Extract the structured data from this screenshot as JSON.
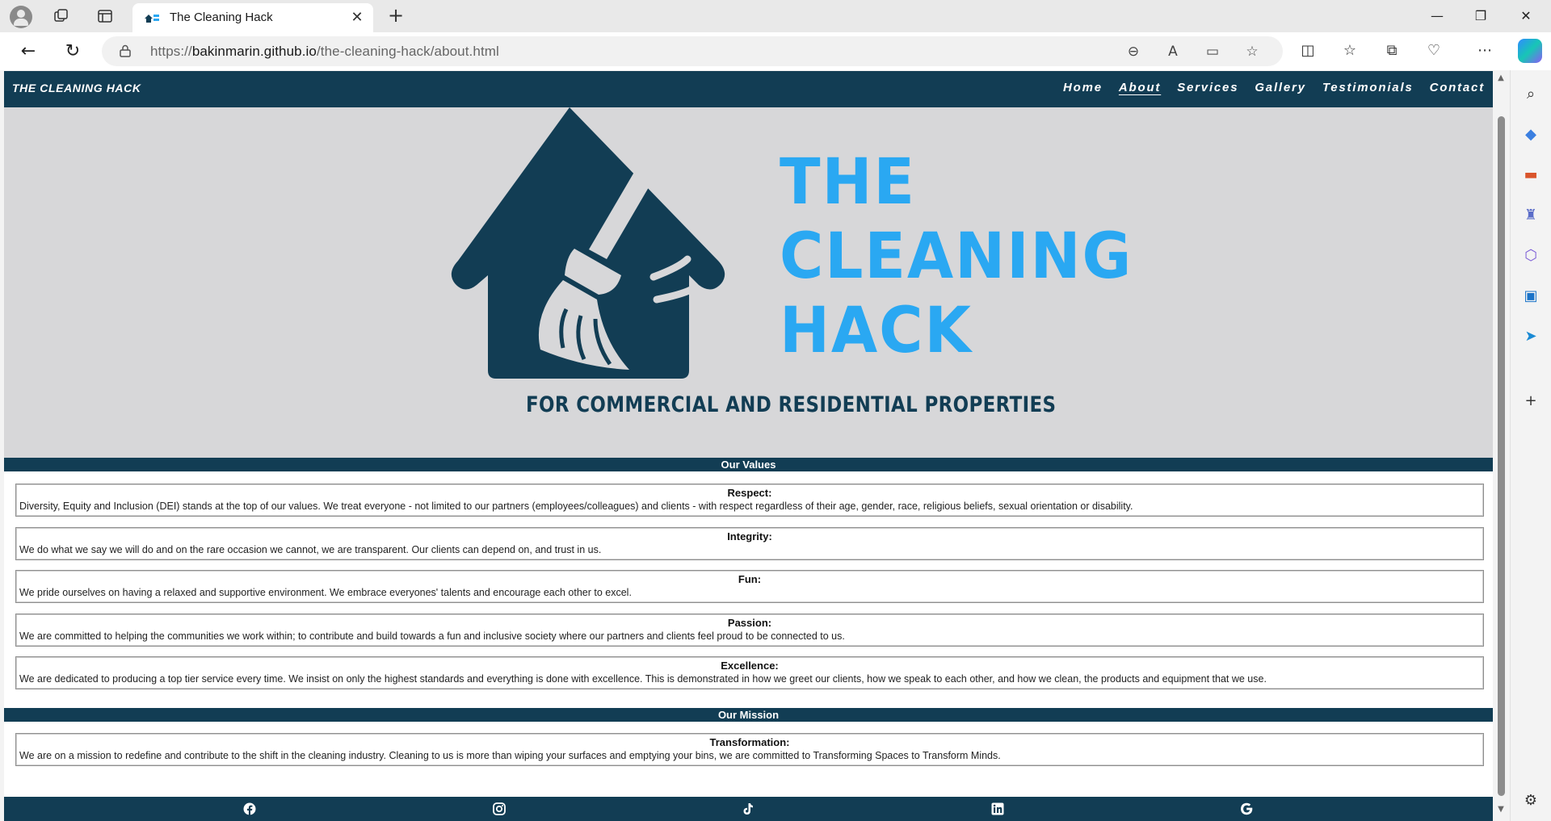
{
  "browser": {
    "tab_title": "The Cleaning Hack",
    "url_prefix": "https://",
    "url_host": "bakinmarin.github.io",
    "url_path": "/the-cleaning-hack/about.html"
  },
  "site": {
    "brand": "THE CLEANING HACK",
    "nav": [
      "Home",
      "About",
      "Services",
      "Gallery",
      "Testimonials",
      "Contact"
    ],
    "active_nav": "About",
    "logo_lines": [
      "THE",
      "CLEANING",
      "HACK"
    ],
    "tagline": "FOR COMMERCIAL AND RESIDENTIAL PROPERTIES",
    "values_heading": "Our Values",
    "values": [
      {
        "title": "Respect:",
        "text": "Diversity, Equity and Inclusion (DEI) stands at the top of our values. We treat everyone - not limited to our partners (employees/colleagues) and clients - with respect regardless of their age, gender, race, religious beliefs, sexual orientation or disability."
      },
      {
        "title": "Integrity:",
        "text": "We do what we say we will do and on the rare occasion we cannot, we are transparent. Our clients can depend on, and trust in us."
      },
      {
        "title": "Fun:",
        "text": "We pride ourselves on having a relaxed and supportive environment. We embrace everyones' talents and encourage each other to excel."
      },
      {
        "title": "Passion:",
        "text": "We are committed to helping the communities we work within; to contribute and build towards a fun and inclusive society where our partners and clients feel proud to be connected to us."
      },
      {
        "title": "Excellence:",
        "text": "We are dedicated to producing a top tier service every time. We insist on only the highest standards and everything is done with excellence. This is demonstrated in how we greet our clients, how we speak to each other, and how we clean, the products and equipment that we use."
      }
    ],
    "mission_heading": "Our Mission",
    "mission": {
      "title": "Transformation:",
      "text": "We are on a mission to redefine and contribute to the shift in the cleaning industry. Cleaning to us is more than wiping your surfaces and emptying your bins, we are committed to Transforming Spaces to Transform Minds."
    },
    "social_icons": [
      "facebook-icon",
      "instagram-icon",
      "tiktok-icon",
      "linkedin-icon",
      "google-icon"
    ]
  },
  "colors": {
    "navy": "#123d54",
    "logo_blue": "#2aa8f2",
    "hero_bg": "#d7d7d9"
  }
}
